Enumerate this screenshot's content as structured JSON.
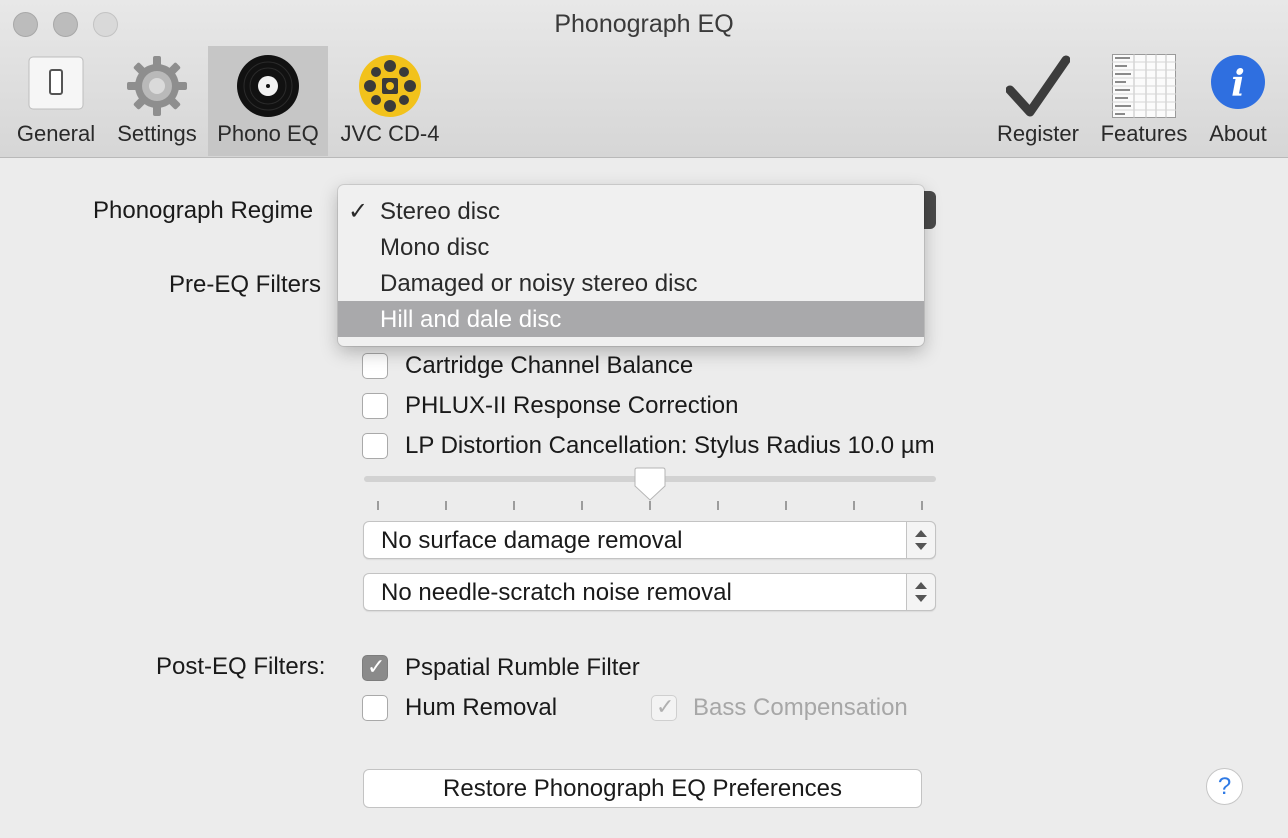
{
  "window": {
    "title": "Phonograph EQ"
  },
  "toolbar": {
    "items": [
      {
        "label": "General",
        "icon": "switch-icon"
      },
      {
        "label": "Settings",
        "icon": "gear-icon"
      },
      {
        "label": "Phono EQ",
        "icon": "vinyl-record-icon",
        "selected": true
      },
      {
        "label": "JVC CD-4",
        "icon": "cd4-icon"
      },
      {
        "label": "Register",
        "icon": "checkmark-icon"
      },
      {
        "label": "Features",
        "icon": "spreadsheet-icon"
      },
      {
        "label": "About",
        "icon": "info-icon"
      }
    ]
  },
  "regime": {
    "label": "Phonograph Regime",
    "options": [
      "Stereo disc",
      "Mono disc",
      "Damaged or noisy stereo disc",
      "Hill and dale disc"
    ],
    "selected": "Stereo disc",
    "highlighted": "Hill and dale disc"
  },
  "pre_eq": {
    "label": "Pre-EQ Filters",
    "checkboxes": [
      {
        "label": "Cartridge Channel Balance",
        "checked": false
      },
      {
        "label": "PHLUX-II Response Correction",
        "checked": false
      },
      {
        "label": "LP Distortion Cancellation: Stylus Radius 10.0 µm",
        "checked": false
      }
    ],
    "stylus_slider": {
      "position": 0.5,
      "ticks": 9
    },
    "surface_damage": {
      "value": "No surface damage removal"
    },
    "needle_scratch": {
      "value": "No needle-scratch noise removal"
    }
  },
  "post_eq": {
    "label": "Post-EQ Filters:",
    "rumble": {
      "label": "Pspatial Rumble Filter",
      "checked": true
    },
    "hum": {
      "label": "Hum Removal",
      "checked": false
    },
    "bass": {
      "label": "Bass Compensation",
      "checked": true,
      "disabled": true
    }
  },
  "restore_button": "Restore Phonograph EQ Preferences",
  "help_button": "?",
  "colors": {
    "accent_blue": "#2f6fe0",
    "cd4_yellow": "#f2c21b",
    "menu_highlight": "#a9a9ab"
  }
}
